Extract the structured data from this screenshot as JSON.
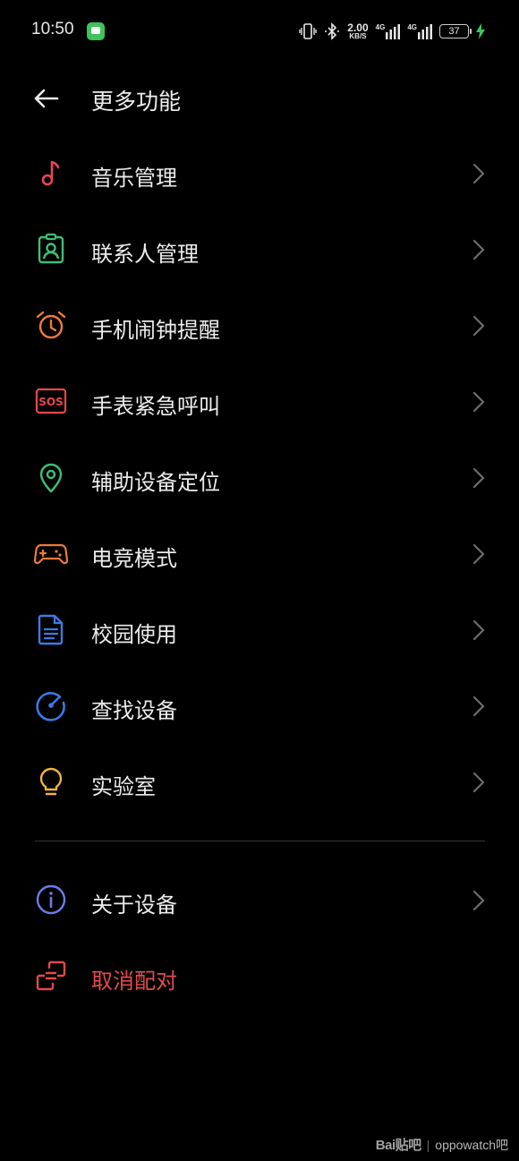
{
  "status_bar": {
    "time": "10:50",
    "speed_value": "2.00",
    "speed_unit": "KB/S",
    "net1": "4G",
    "net2": "4G",
    "battery": "37"
  },
  "header": {
    "title": "更多功能"
  },
  "menu": [
    {
      "label": "音乐管理",
      "icon": "music-note-icon",
      "color": "#e5484d"
    },
    {
      "label": "联系人管理",
      "icon": "contact-badge-icon",
      "color": "#3fbf74"
    },
    {
      "label": "手机闹钟提醒",
      "icon": "alarm-clock-icon",
      "color": "#ee7b3a"
    },
    {
      "label": "手表紧急呼叫",
      "icon": "sos-icon",
      "color": "#e5484d"
    },
    {
      "label": "辅助设备定位",
      "icon": "location-pin-icon",
      "color": "#3fbf74"
    },
    {
      "label": "电竞模式",
      "icon": "gamepad-icon",
      "color": "#ee7b3a"
    },
    {
      "label": "校园使用",
      "icon": "document-icon",
      "color": "#3c7be6"
    },
    {
      "label": "查找设备",
      "icon": "find-device-icon",
      "color": "#3c7be6"
    },
    {
      "label": "实验室",
      "icon": "lightbulb-icon",
      "color": "#f2b43c"
    }
  ],
  "menu_bottom": [
    {
      "label": "关于设备",
      "icon": "info-icon",
      "color": "#6a7ee8"
    },
    {
      "label": "取消配对",
      "icon": "unpair-icon",
      "color": "#e5484d"
    }
  ],
  "watermark": {
    "logo": "Bai贴吧",
    "text": "oppowatch吧"
  }
}
